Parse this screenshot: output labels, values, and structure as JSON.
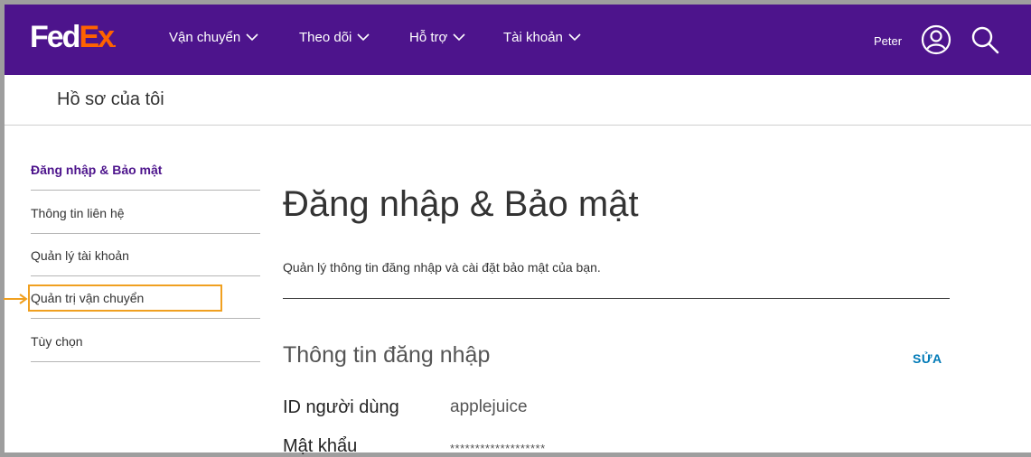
{
  "brand": {
    "part1": "Fed",
    "part2": "Ex",
    "dot": ".",
    "accent": "#ff6200",
    "header_bg": "#4d148c"
  },
  "nav": {
    "items": [
      {
        "label": "Vận chuyển"
      },
      {
        "label": "Theo dõi"
      },
      {
        "label": "Hỗ trợ"
      },
      {
        "label": "Tài khoản"
      }
    ],
    "user_name": "Peter"
  },
  "profile_bar": {
    "title": "Hồ sơ của tôi"
  },
  "sidebar": {
    "items": [
      {
        "label": "Đăng nhập & Bảo mật",
        "active": true
      },
      {
        "label": "Thông tin liên hệ",
        "active": false
      },
      {
        "label": "Quản lý tài khoản",
        "active": false
      },
      {
        "label": "Quản trị vận chuyển",
        "active": false,
        "highlighted": true
      },
      {
        "label": "Tùy chọn",
        "active": false
      }
    ]
  },
  "main": {
    "title": "Đăng nhập & Bảo mật",
    "description": "Quản lý thông tin đăng nhập và cài đặt bảo mật của bạn.",
    "section_title": "Thông tin đăng nhập",
    "edit_label": "SỬA",
    "fields": [
      {
        "label": "ID người dùng",
        "value": "applejuice"
      },
      {
        "label": "Mật khẩu",
        "value": "*******************"
      }
    ]
  },
  "colors": {
    "link": "#007ab7",
    "highlight_box": "#f0a020"
  }
}
